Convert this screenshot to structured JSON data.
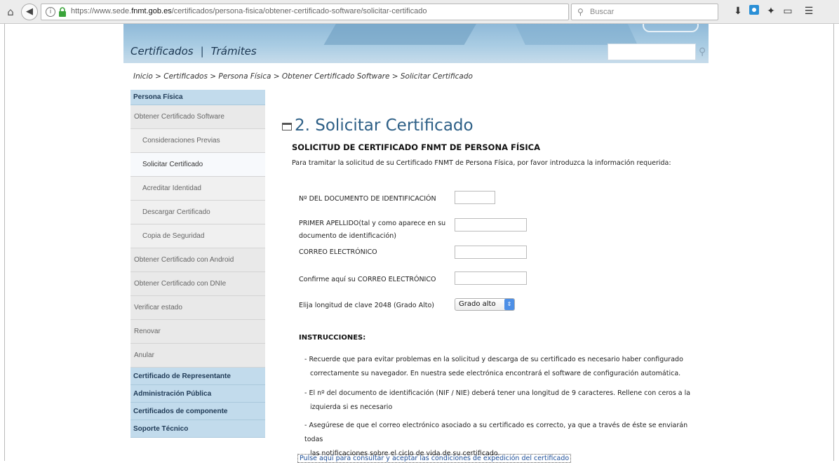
{
  "browser": {
    "url_host_prefix": "https://www.sede.",
    "url_host": "fnmt.gob.es",
    "url_path": "/certificados/persona-fisica/obtener-certificado-software/solicitar-certificado",
    "search_placeholder": "Buscar"
  },
  "banner": {
    "nav_certificados": "Certificados",
    "nav_separator": "|",
    "nav_tramites": "Trámites"
  },
  "breadcrumb": {
    "text": "Inicio > Certificados > Persona Física > Obtener Certificado Software >  Solicitar Certificado"
  },
  "sidebar": {
    "head_persona": "Persona Física",
    "items": [
      {
        "label": "Obtener Certificado Software"
      },
      {
        "label": "Consideraciones Previas"
      },
      {
        "label": "Solicitar Certificado"
      },
      {
        "label": "Acreditar Identidad"
      },
      {
        "label": "Descargar Certificado"
      },
      {
        "label": "Copia de Seguridad"
      },
      {
        "label": "Obtener Certificado con Android"
      },
      {
        "label": "Obtener Certificado con DNIe"
      },
      {
        "label": "Verificar estado"
      },
      {
        "label": "Renovar"
      },
      {
        "label": "Anular"
      }
    ],
    "heads": [
      {
        "label": "Certificado de Representante"
      },
      {
        "label": "Administración Pública"
      },
      {
        "label": "Certificados de componente"
      },
      {
        "label": "Soporte Técnico"
      }
    ]
  },
  "main": {
    "title": "2. Solicitar Certificado",
    "section_title": "SOLICITUD DE CERTIFICADO FNMT DE PERSONA FÍSICA",
    "intro": "Para tramitar la solicitud de su Certificado FNMT de Persona Física, por favor introduzca la información requerida:",
    "labels": {
      "doc_id": "Nº DEL DOCUMENTO DE IDENTIFICACIÓN",
      "apellido_1": "PRIMER APELLIDO(tal y como aparece en su",
      "apellido_2": "documento de identificación)",
      "email": "CORREO ELECTRÓNICO",
      "email_confirm": "Confirme aquí su CORREO ELECTRÓNICO",
      "key_length": "Elija longitud de clave  2048  (Grado Alto)"
    },
    "values": {
      "doc_id": "",
      "apellido": "",
      "email": "",
      "email_confirm": ""
    },
    "select_value": "Grado alto",
    "instructions_title": "INSTRUCCIONES:",
    "instructions": [
      {
        "line1": "- Recuerde que para evitar problemas en la solicitud y descarga de su certificado es necesario haber configurado",
        "line2": "correctamente su navegador. En nuestra sede electrónica encontrará el software de configuración automática."
      },
      {
        "line1": "- El nº del documento de identificación (NIF / NIE) deberá tener una longitud de 9 caracteres. Rellene con ceros a la",
        "line2": "izquierda si es necesario"
      },
      {
        "line1": "- Asegúrese de que el correo electrónico asociado a su certificado es correcto, ya que a través de éste se enviarán todas",
        "line2": "las notificaciones sobre el ciclo de vida de su certificado."
      }
    ],
    "footer_link": "Pulse aquí para consultar y aceptar las condiciones de expedición del certificado"
  }
}
